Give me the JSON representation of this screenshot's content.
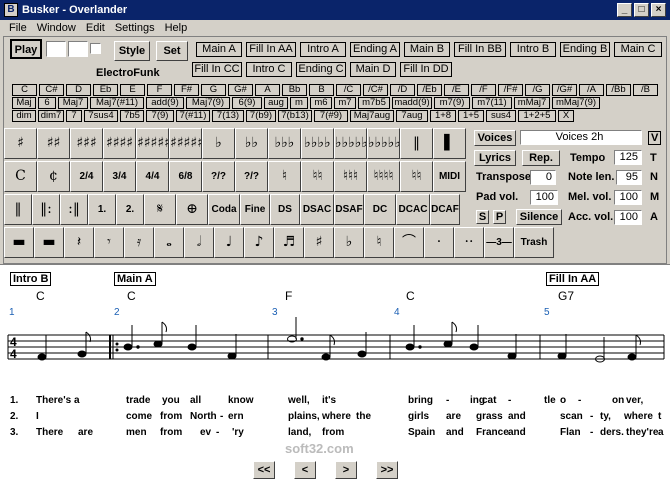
{
  "window": {
    "title": "Busker - Overlander",
    "minimize": "_",
    "maximize": "□",
    "close": "×",
    "app_icon": "B"
  },
  "menu": [
    "File",
    "Window",
    "Edit",
    "Settings",
    "Help"
  ],
  "controls": {
    "play": "Play",
    "style": "Style",
    "set": "Set",
    "style_name": "ElectroFunk"
  },
  "parts_row1": [
    "Main A",
    "Fill In AA",
    "Intro A",
    "Ending A",
    "Main B",
    "Fill In BB",
    "Intro B",
    "Ending B",
    "Main C"
  ],
  "parts_row2": [
    "Fill In CC",
    "Intro C",
    "Ending C",
    "Main D",
    "Fill In DD"
  ],
  "chord_roots": [
    "C",
    "C#",
    "D",
    "Eb",
    "E",
    "F",
    "F#",
    "G",
    "G#",
    "A",
    "Bb",
    "B",
    "/C",
    "/C#",
    "/D",
    "/Eb",
    "/E",
    "/F",
    "/F#",
    "/G",
    "/G#",
    "/A",
    "/Bb",
    "/B"
  ],
  "chord_types1": [
    "Maj",
    "6",
    "Maj7",
    "Maj7(#11)",
    "add(9)",
    "Maj7(9)",
    "6(9)",
    "aug",
    "m",
    "m6",
    "m7",
    "m7b5",
    "madd(9)",
    "m7(9)",
    "m7(11)",
    "mMaj7",
    "mMaj7(9)"
  ],
  "chord_types2": [
    "dim",
    "dim7",
    "7",
    "7sus4",
    "7b5",
    "7(9)",
    "7(#11)",
    "7(13)",
    "7(b9)",
    "7(b13)",
    "7(#9)",
    "Maj7aug",
    "7aug",
    "1+8",
    "1+5",
    "sus4",
    "1+2+5",
    "X"
  ],
  "symbols_row1": [
    "♯",
    "♯♯",
    "♯♯♯",
    "♯♯♯♯",
    "♯♯♯♯♯",
    "♯♯♯♯♯♯",
    "♭",
    "♭♭",
    "♭♭♭",
    "♭♭♭♭",
    "♭♭♭♭♭",
    "♭♭♭♭♭♭",
    "‖",
    "▌"
  ],
  "symbols_row2": [
    "C",
    "¢",
    "2/4",
    "3/4",
    "4/4",
    "6/8",
    "?/?",
    "?/?",
    "♮",
    "♮♮",
    "♮♮♮",
    "♮♮♮♮",
    "♮♮",
    "MIDI"
  ],
  "symbols_row3": [
    "‖",
    "‖:",
    ":‖",
    "1.",
    "2.",
    "𝄋",
    "⊕",
    "Coda",
    "Fine",
    "DS",
    "DSAC",
    "DSAF",
    "DC",
    "DCAC",
    "DCAF"
  ],
  "symbols_row4": [
    "▬",
    "▬",
    "𝄽",
    "𝄾",
    "𝄿",
    "𝅝",
    "𝅗𝅥",
    "♩",
    "♪",
    "♬",
    "♯",
    "♭",
    "♮",
    "⌒",
    "·",
    "··",
    "—3—",
    "Trash box"
  ],
  "right_panel": {
    "voices_btn": "Voices",
    "voices_value": "Voices 2h",
    "voices_flag": "V",
    "lyrics_btn": "Lyrics",
    "rep_btn": "Rep.",
    "tempo_label": "Tempo",
    "tempo_value": "125",
    "tempo_flag": "T",
    "transpose_label": "Transpose",
    "transpose_value": "0",
    "note_len_label": "Note len.",
    "note_len_value": "95",
    "note_len_flag": "N",
    "pad_vol_label": "Pad vol.",
    "pad_vol_value": "100",
    "mel_vol_label": "Mel. vol.",
    "mel_vol_value": "100",
    "mel_vol_flag": "M",
    "s_btn": "S",
    "p_btn": "P",
    "silence_btn": "Silence",
    "acc_vol_label": "Acc. vol.",
    "acc_vol_value": "100",
    "acc_vol_flag": "A"
  },
  "score": {
    "parts": [
      "Intro B",
      "Main A",
      "Fill In AA"
    ],
    "chords": [
      "C",
      "C",
      "F",
      "C",
      "G7"
    ],
    "bar_numbers": [
      "1",
      "2",
      "3",
      "4",
      "5"
    ],
    "time_signature": "4/4",
    "lyrics": [
      {
        "num": "1.",
        "words": [
          "There's a",
          "trade",
          "you",
          "all",
          "know",
          "well,",
          "it's",
          "bring",
          "-",
          "ing",
          "cat",
          "-",
          "tle",
          "o",
          "-",
          "ver,",
          "on"
        ]
      },
      {
        "num": "2.",
        "words": [
          "I",
          "come",
          "from",
          "North",
          "-",
          "ern",
          "plains,",
          "where",
          "the",
          "girls",
          "are",
          "grass",
          "and",
          "scan",
          "-",
          "ty,",
          "where",
          "t"
        ]
      },
      {
        "num": "3.",
        "words": [
          "There",
          "are",
          "men",
          "from",
          "ev",
          "-",
          "'ry",
          "land,",
          "from",
          "Spain",
          "and",
          "France",
          "and",
          "Flan",
          "-",
          "ders.",
          "they're",
          "a"
        ]
      }
    ]
  },
  "watermark": "soft32.com",
  "nav": [
    "<<",
    "<",
    ">",
    ">>"
  ]
}
